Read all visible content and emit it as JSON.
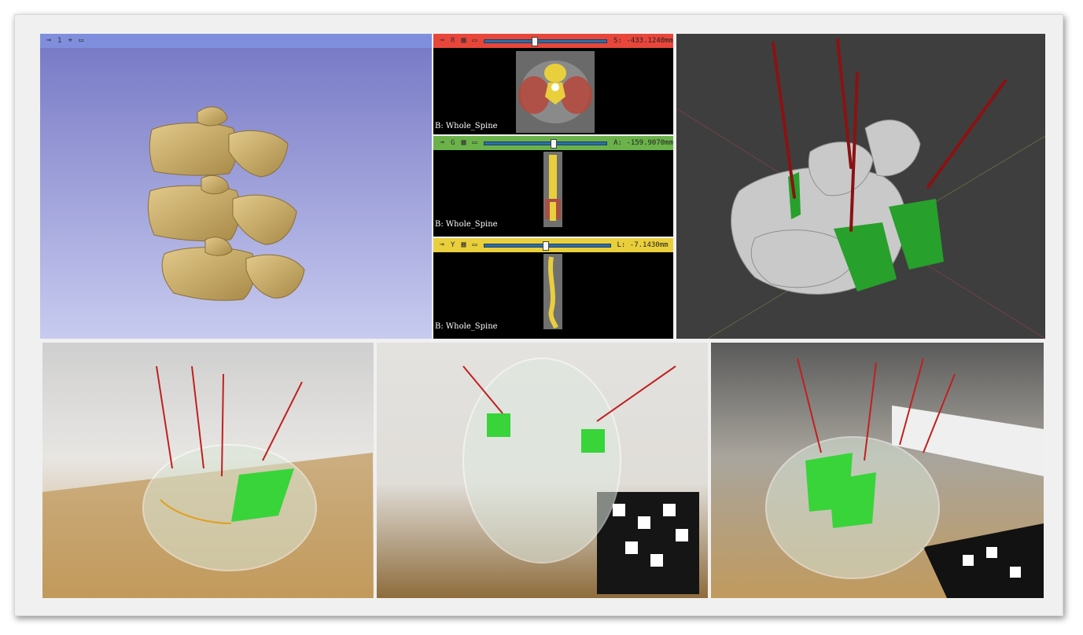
{
  "views": {
    "red": {
      "letter": "R",
      "offset": "S: -433.1240mm",
      "label": "B: Whole_Spine",
      "color": "#e8463a",
      "slider_fraction": 0.38
    },
    "green": {
      "letter": "G",
      "offset": "A: -159.9070mm",
      "label": "B: Whole_Spine",
      "color": "#6bb24a",
      "slider_fraction": 0.52
    },
    "yellow": {
      "letter": "Y",
      "offset": "L: -7.1430mm",
      "label": "B: Whole_Spine",
      "color": "#e9cf3c",
      "slider_fraction": 0.46
    }
  },
  "view3d": {
    "number": "1",
    "bar_color": "#7f8fdd"
  },
  "icons": [
    "pin-icon",
    "crosshair-icon",
    "window-icon",
    "slice-stack-icon"
  ]
}
